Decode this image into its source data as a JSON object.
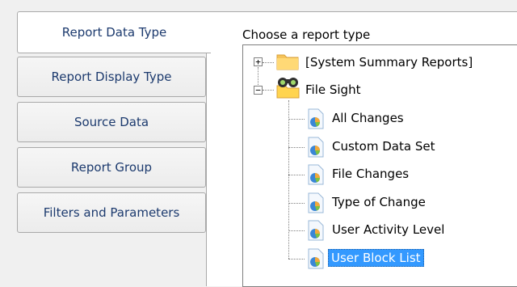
{
  "tabs": [
    {
      "label": "Report Data Type",
      "selected": true
    },
    {
      "label": "Report Display Type",
      "selected": false
    },
    {
      "label": "Source Data",
      "selected": false
    },
    {
      "label": "Report Group",
      "selected": false
    },
    {
      "label": "Filters and Parameters",
      "selected": false
    }
  ],
  "panel": {
    "label": "Choose a report type"
  },
  "tree": {
    "groups": [
      {
        "label": "[System Summary Reports]",
        "expander": "+",
        "icon": "folder-icon"
      },
      {
        "label": "File Sight",
        "expander": "−",
        "icon": "binoculars-folder-icon"
      }
    ],
    "children": [
      {
        "label": "All Changes",
        "icon": "report-pie-icon"
      },
      {
        "label": "Custom Data Set",
        "icon": "report-pie-icon"
      },
      {
        "label": "File Changes",
        "icon": "report-pie-icon"
      },
      {
        "label": "Type of Change",
        "icon": "report-pie-icon"
      },
      {
        "label": "User Activity Level",
        "icon": "report-pie-icon"
      },
      {
        "label": "User Block List",
        "icon": "report-pie-icon",
        "selected": true
      }
    ]
  },
  "colors": {
    "selection": "#3399ff",
    "tab_text": "#1c3a6e"
  }
}
